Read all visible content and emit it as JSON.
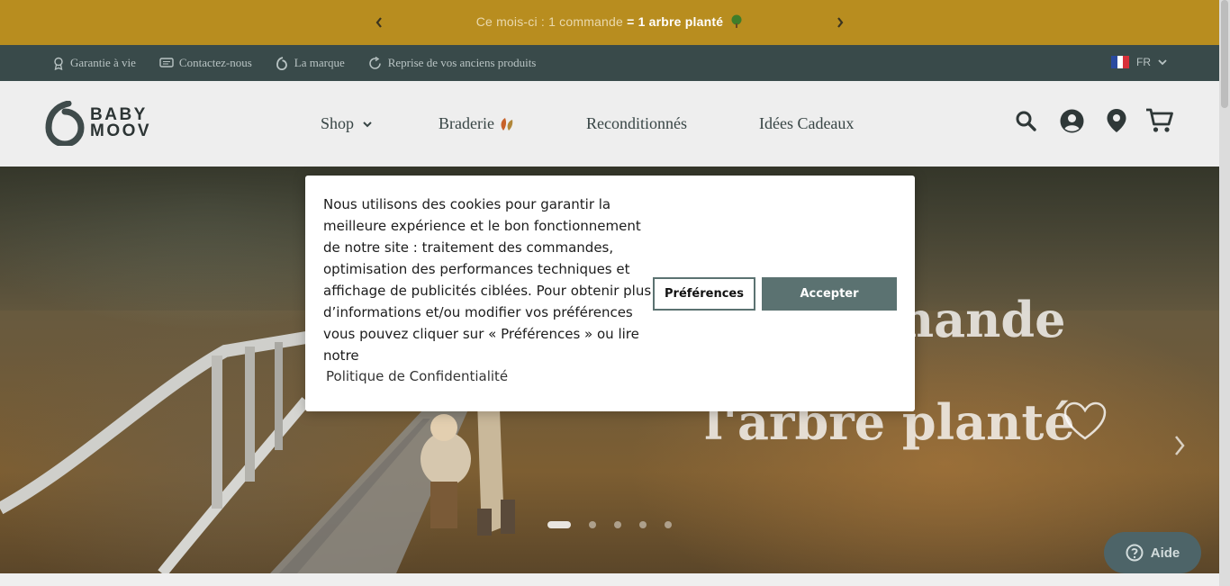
{
  "announcement": {
    "text_prefix": "Ce mois-ci : 1 commande ",
    "text_bold": "= 1 arbre planté",
    "tree_icon": "tree-emoji-icon",
    "bg_color": "#b88d1f"
  },
  "utility_bar": {
    "items": [
      {
        "label": "Garantie à vie",
        "icon": "ribbon-badge-icon"
      },
      {
        "label": "Contactez-nous",
        "icon": "chat-bubble-icon"
      },
      {
        "label": "La marque",
        "icon": "brand-logo-icon"
      },
      {
        "label": "Reprise de vos anciens produits",
        "icon": "refresh-icon"
      }
    ],
    "language": "FR",
    "bg_color": "#394a4a"
  },
  "header": {
    "logo": {
      "line1": "BABY",
      "line2": "MOOV"
    },
    "nav": [
      {
        "label": "Shop",
        "has_dropdown": true
      },
      {
        "label": "Braderie",
        "icon": "leaves-icon"
      },
      {
        "label": "Reconditionnés"
      },
      {
        "label": "Idées Cadeaux"
      }
    ],
    "icons": [
      "search-icon",
      "account-icon",
      "location-pin-icon",
      "cart-icon"
    ]
  },
  "hero": {
    "line1": "mande",
    "line2": "l'arbre planté",
    "slides_total": 5,
    "active_slide": 1
  },
  "cookie_banner": {
    "text": "Nous utilisons des cookies pour garantir la meilleure expérience et le bon fonctionnement de notre site : traitement des commandes, optimisation des performances techniques et affichage de publicités ciblées. Pour obtenir plus d’informations et/ou modifier vos préférences vous pouvez cliquer sur « Préférences » ou lire notre",
    "policy_link": "Politique de Confidentialité",
    "preferences_label": "Préférences",
    "accept_label": "Accepter",
    "accent_color": "#5b7271"
  },
  "help": {
    "label": "Aide"
  }
}
